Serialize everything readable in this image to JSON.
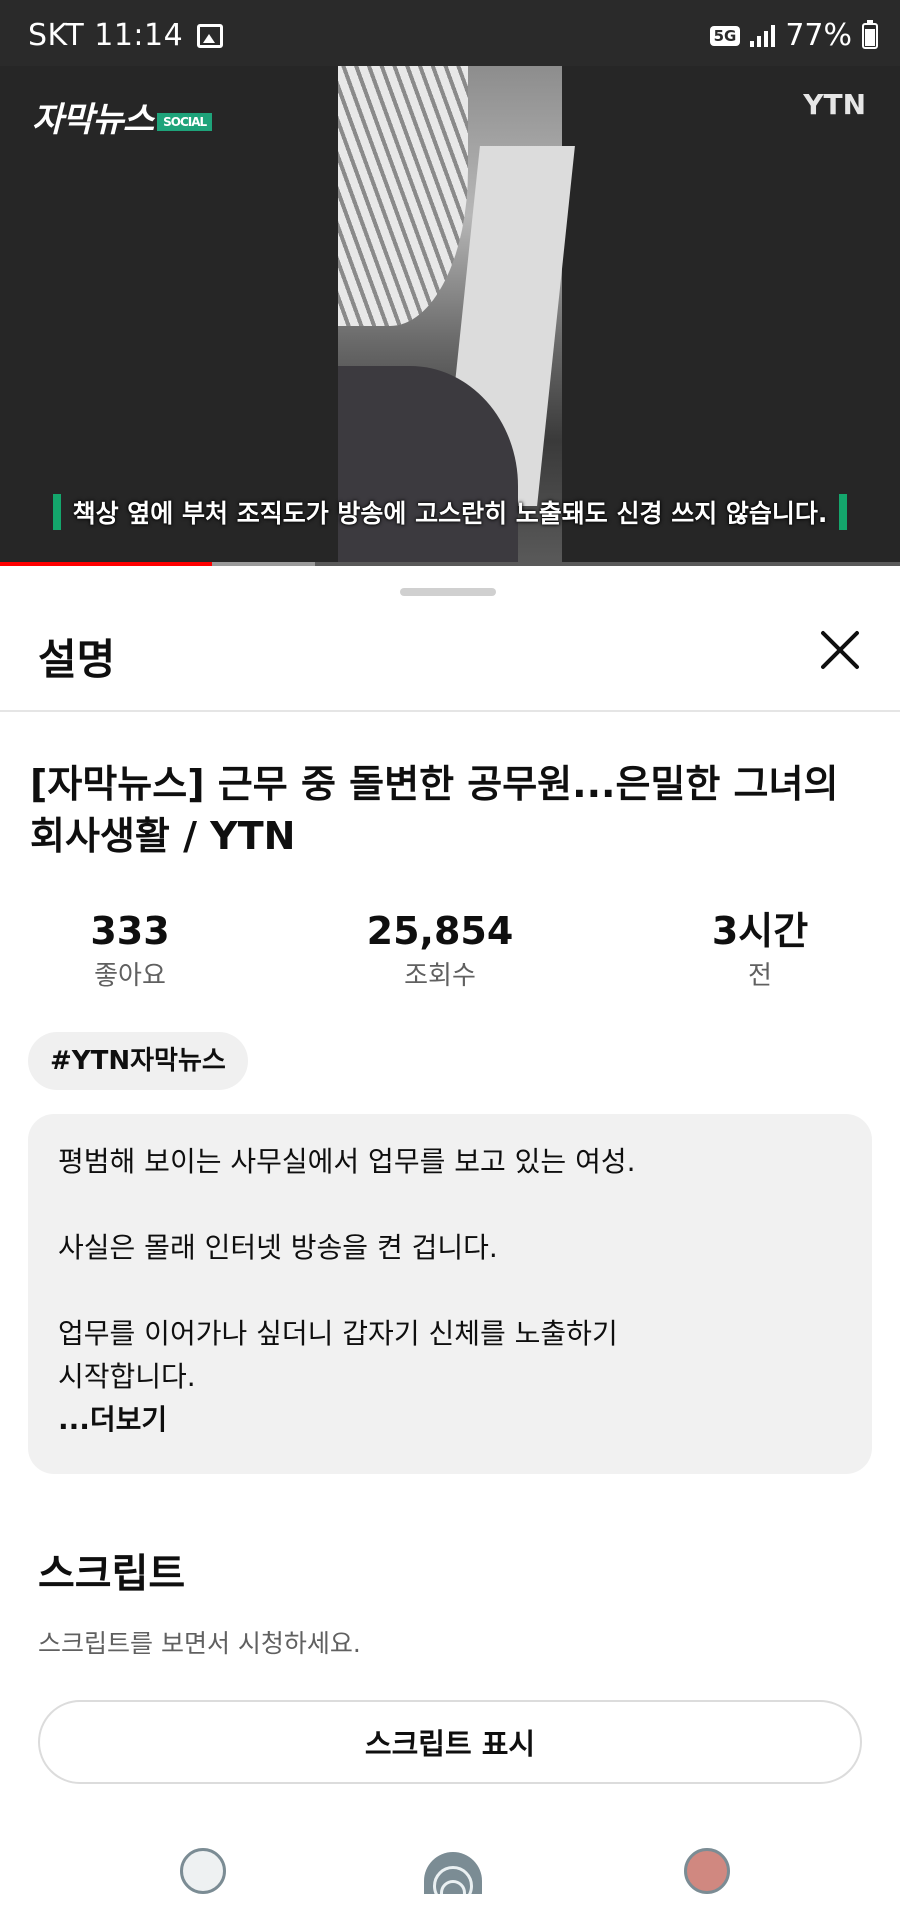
{
  "status_bar": {
    "carrier_time": "SKT 11:14",
    "network": "5G",
    "battery": "77%"
  },
  "video": {
    "brand_logo": "자막뉴스",
    "brand_tag": "SOCIAL",
    "channel_logo": "YTN",
    "subtitle": "책상 옆에 부처 조직도가 방송에 고스란히 노출돼도 신경 쓰지 않습니다.",
    "progress": 0.235,
    "buffered": 0.35,
    "colors": {
      "progress_played": "#ff0000",
      "subtitle_bar": "#14a66c"
    }
  },
  "sheet": {
    "title": "설명",
    "close_icon": "close-icon",
    "video_title": "[자막뉴스] 근무 중 돌변한 공무원...은밀한 그녀의 회사생활 / YTN",
    "stats": [
      {
        "value": "333",
        "label": "좋아요"
      },
      {
        "value": "25,854",
        "label": "조회수"
      },
      {
        "value": "3시간",
        "label": "전"
      }
    ],
    "hashtag": "#YTN자막뉴스",
    "description": {
      "line1": "평범해 보이는 사무실에서 업무를 보고 있는 여성.",
      "line2": "사실은 몰래 인터넷 방송을 켠 겁니다.",
      "line3": "업무를 이어가나 싶더니 갑자기 신체를 노출하기",
      "line4": "시작합니다.",
      "more": "...더보기"
    },
    "script": {
      "title": "스크립트",
      "subtitle": "스크립트를 보면서 시청하세요.",
      "button": "스크립트 표시"
    }
  },
  "bottom_nav": {
    "icons": [
      "back-nav-icon",
      "home-nav-icon",
      "recent-nav-icon"
    ]
  }
}
